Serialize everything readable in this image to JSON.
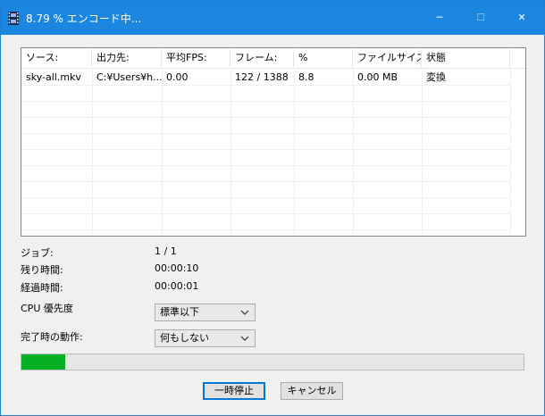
{
  "window": {
    "title": "8.79 % エンコード中...",
    "controls": {
      "minimize": "─",
      "maximize": "☐",
      "close": "✕"
    }
  },
  "table": {
    "headers": [
      "ソース:",
      "出力先:",
      "平均FPS:",
      "フレーム:",
      "%",
      "ファイルサイズ:",
      "状態"
    ],
    "rows": [
      [
        "sky-all.mkv",
        "C:¥Users¥h...",
        "0.00",
        "122 / 1388",
        "8.8",
        "0.00 MB",
        "変換"
      ]
    ]
  },
  "info": {
    "job_label": "ジョブ:",
    "job_value": "1 / 1",
    "remaining_label": "残り時間:",
    "remaining_value": "00:00:10",
    "elapsed_label": "経過時間:",
    "elapsed_value": "00:00:01",
    "cpu_priority_label": "CPU 優先度",
    "cpu_priority_value": "標準以下",
    "on_complete_label": "完了時の動作:",
    "on_complete_value": "何もしない"
  },
  "progress": {
    "percent": 8.79
  },
  "buttons": {
    "pause": "一時停止",
    "cancel": "キャンセル"
  },
  "colors": {
    "titlebar": "#1b86e0",
    "progress_fill": "#06b025",
    "focus": "#0078d7"
  }
}
